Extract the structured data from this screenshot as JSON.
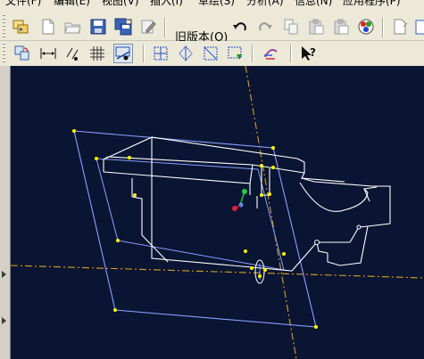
{
  "menubar": {
    "items": [
      "文件(F)",
      "编辑(E)",
      "视图(V)",
      "插入(I)",
      "草绘(S)",
      "分析(A)",
      "信息(N)",
      "应用程序(P)"
    ]
  },
  "toolbar1": {
    "old_version_label": "旧版本(O)",
    "icons": [
      "select-filter-icon",
      "new-file-icon",
      "open-folder-icon",
      "save-icon",
      "save-copy-icon",
      "edit-icon",
      "old-version-icon",
      "undo-icon",
      "redo-icon",
      "copy-icon",
      "paste-icon",
      "paste-special-icon",
      "color-palette-icon",
      "sketch-plane-icon",
      "datum-icon"
    ]
  },
  "toolbar2": {
    "icons": [
      "repaint-icon",
      "dimension-display-icon",
      "constraint-display-icon",
      "grid-display-icon",
      "vertex-display-icon",
      "intersect-icon",
      "mirror-icon",
      "trim-icon",
      "move-resize-icon",
      "palette-icon",
      "whats-this-icon"
    ]
  },
  "colors": {
    "viewport_background": "#0a1433",
    "model_lines": "#ffffff",
    "sketch_plane": "#8aa0ff",
    "centerline": "#e0a020",
    "vertex": "#ffff00"
  }
}
